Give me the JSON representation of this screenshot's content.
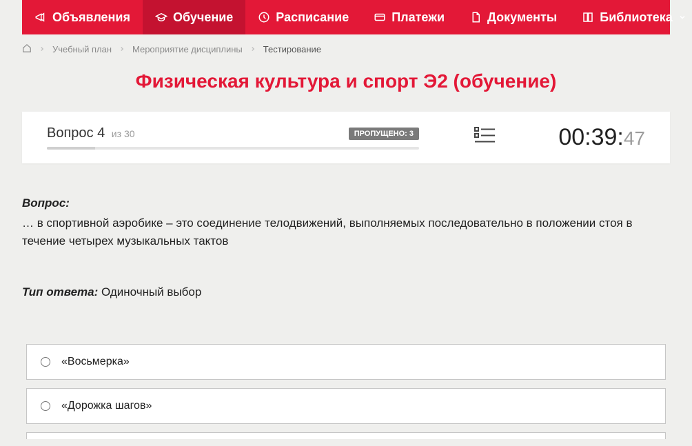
{
  "nav": [
    {
      "icon": "megaphone",
      "label": "Объявления"
    },
    {
      "icon": "cap",
      "label": "Обучение",
      "active": true
    },
    {
      "icon": "clock",
      "label": "Расписание"
    },
    {
      "icon": "card",
      "label": "Платежи"
    },
    {
      "icon": "doc",
      "label": "Документы"
    },
    {
      "icon": "book",
      "label": "Библиотека",
      "dropdown": true
    }
  ],
  "breadcrumb": {
    "home": "home",
    "items": [
      "Учебный план",
      "Мероприятие дисциплины"
    ],
    "current": "Тестирование"
  },
  "title": "Физическая культура и спорт Э2 (обучение)",
  "status": {
    "question_word": "Вопрос",
    "question_number": "4",
    "of_word": "из",
    "total_questions": "30",
    "skipped_label": "ПРОПУЩЕНО: 3",
    "progress_percent": 13,
    "timer_main": "00:39:",
    "timer_seconds": "47"
  },
  "question": {
    "label": "Вопрос:",
    "text": "… в спортивной аэробике – это соединение телодвижений, выполняемых последовательно в положении стоя в течение четырех музыкальных тактов"
  },
  "answer_type": {
    "label": "Тип ответа:",
    "value": "Одиночный выбор"
  },
  "answers": [
    {
      "text": "«Восьмерка»"
    },
    {
      "text": "«Дорожка шагов»"
    }
  ]
}
